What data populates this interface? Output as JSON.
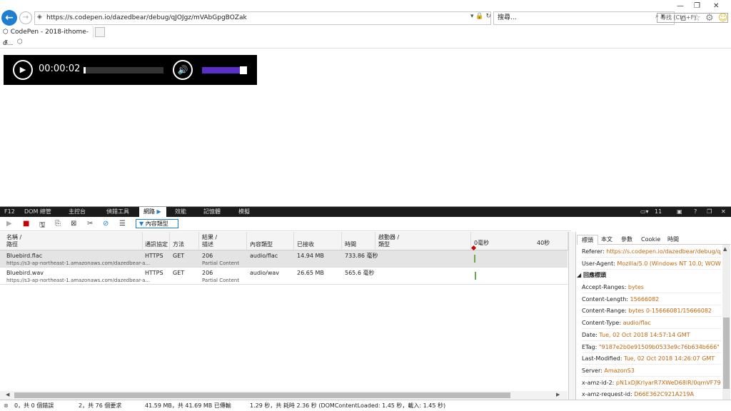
{
  "browser": {
    "url": "https://s.codepen.io/dazedbear/debug/qJOJgz/mVAbGpgBOZak",
    "search_placeholder": "搜尋...",
    "tab_title": "CodePen - 2018-ithome-d...",
    "fav_close": "x"
  },
  "player": {
    "time": "00:00:02",
    "progress_fraction": 0.03,
    "volume_fraction": 0.85
  },
  "devtools": {
    "f12": "F12",
    "tabs": [
      "DOM 總管",
      "主控台",
      "偵錯工具",
      "網路",
      "效能",
      "記憶體",
      "模擬"
    ],
    "active_tab": "網路",
    "device_count": "11",
    "filter_label": "內容類型",
    "find_placeholder": "尋找 (Ctrl+F)",
    "columns": {
      "name": "名稱 /",
      "name2": "路徑",
      "protocol": "通訊協定",
      "method": "方法",
      "result": "結果 /",
      "result2": "描述",
      "content_type": "內容類型",
      "received": "已接收",
      "time": "時間",
      "initiator": "啟動器 /",
      "initiator2": "類型",
      "timeline_0": "0毫秒",
      "timeline_40": "40秒"
    },
    "rows": [
      {
        "name": "Bluebird.flac",
        "path": "https://s3-ap-northeast-1.amazonaws.com/dazedbear-a...",
        "protocol": "HTTPS",
        "method": "GET",
        "status": "206",
        "status_text": "Partial Content",
        "type": "audio/flac",
        "received": "14.94 MB",
        "time": "733.86 毫秒"
      },
      {
        "name": "Bluebird.wav",
        "path": "https://s3-ap-northeast-1.amazonaws.com/dazedbear-a...",
        "protocol": "HTTPS",
        "method": "GET",
        "status": "206",
        "status_text": "Partial Content",
        "type": "audio/wav",
        "received": "26.65 MB",
        "time": "565.6 毫秒"
      }
    ],
    "detail_tabs": [
      "標頭",
      "本文",
      "參數",
      "Cookie",
      "時間"
    ],
    "request_headers": [
      {
        "k": "Referer:",
        "v": "https://s.codepen.io/dazedbear/debug/qJOJ..."
      },
      {
        "k": "User-Agent:",
        "v": "Mozilla/5.0 (Windows NT 10.0; WOW64;..."
      }
    ],
    "response_section": "回應標頭",
    "response_headers": [
      {
        "k": "Accept-Ranges:",
        "v": "bytes"
      },
      {
        "k": "Content-Length:",
        "v": "15666082"
      },
      {
        "k": "Content-Range:",
        "v": "bytes 0-15666081/15666082"
      },
      {
        "k": "Content-Type:",
        "v": "audio/flac"
      },
      {
        "k": "Date:",
        "v": "Tue, 02 Oct 2018 14:57:14 GMT"
      },
      {
        "k": "ETag:",
        "v": "\"9187e2b0e91509b0533e9c76b634b666\""
      },
      {
        "k": "Last-Modified:",
        "v": "Tue, 02 Oct 2018 14:26:07 GMT"
      },
      {
        "k": "Server:",
        "v": "AmazonS3"
      },
      {
        "k": "x-amz-id-2:",
        "v": "pN1xDJKrlyarR7XWeD68lR/0qmVF79zKq..."
      },
      {
        "k": "x-amz-request-id:",
        "v": "D66E362C921A219A"
      }
    ],
    "status": {
      "errors": "0，共 0 個錯誤",
      "requests": "2，共 76 個要求",
      "transferred": "41.59 MB，共 41.69 MB 已傳輸",
      "timing": "1.29 秒，共 耗時 2.36 秒 (DOMContentLoaded: 1.45 秒，載入: 1.45 秒)"
    }
  }
}
